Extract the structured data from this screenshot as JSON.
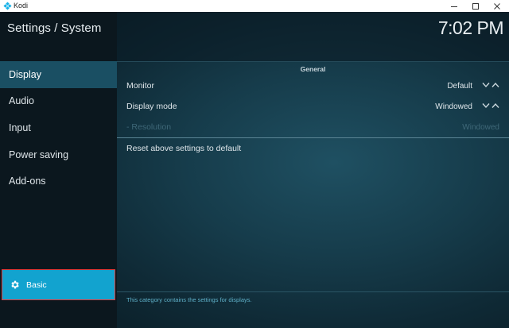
{
  "window": {
    "app_name": "Kodi",
    "minimize_icon": "minimize-icon",
    "maximize_icon": "maximize-icon",
    "close_icon": "close-icon"
  },
  "header": {
    "title": "Settings / System",
    "clock": "7:02 PM"
  },
  "sidebar": {
    "items": [
      {
        "label": "Display",
        "active": true
      },
      {
        "label": "Audio",
        "active": false
      },
      {
        "label": "Input",
        "active": false
      },
      {
        "label": "Power saving",
        "active": false
      },
      {
        "label": "Add-ons",
        "active": false
      }
    ],
    "level_button": {
      "label": "Basic",
      "icon": "gear-icon"
    }
  },
  "content": {
    "group_title": "General",
    "settings": [
      {
        "label": "Monitor",
        "value": "Default"
      },
      {
        "label": "Display mode",
        "value": "Windowed"
      },
      {
        "label": "- Resolution",
        "value": "Windowed",
        "disabled": true
      }
    ],
    "reset_label": "Reset above settings to default",
    "description": "This category contains the settings for displays."
  },
  "colors": {
    "accent": "#12a3cf",
    "sidebar_active": "#1a4f63",
    "highlight_border": "#e03a3a"
  }
}
